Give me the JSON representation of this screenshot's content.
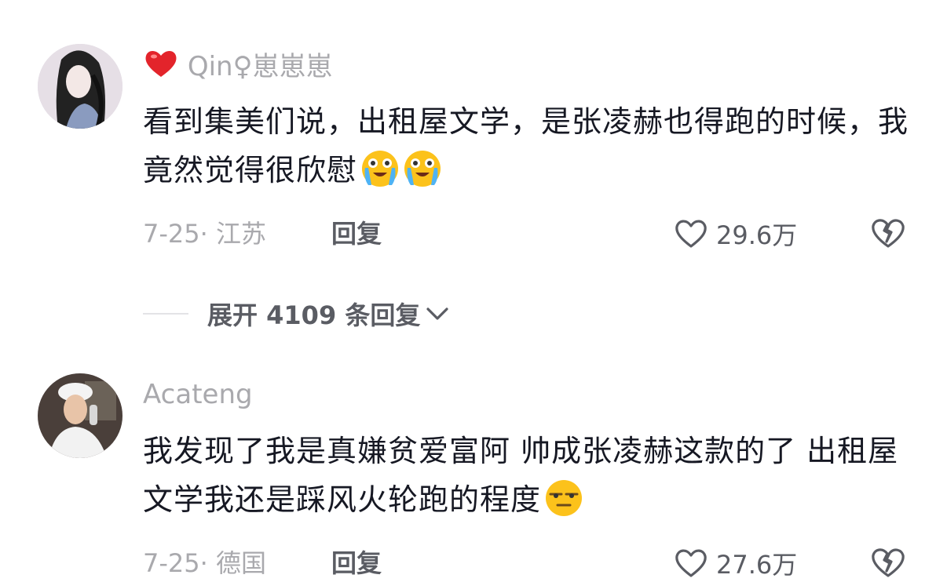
{
  "comments": [
    {
      "username": "Qin♀崽崽崽",
      "username_icon": "red-heart-icon",
      "text": "看到集美们说，出租屋文学，是张凌赫也得跑的时候，我竟然觉得很欣慰",
      "emojis": [
        "crying-emoji",
        "crying-emoji"
      ],
      "date_location": "7-25· 江苏",
      "reply_label": "回复",
      "likes": "29.6万"
    },
    {
      "username": "Acateng",
      "text": "我发现了我是真嫌贫爱富阿 帅成张凌赫这款的了 出租屋文学我还是踩风火轮跑的程度",
      "emojis": [
        "eye-roll-emoji"
      ],
      "date_location": "7-25· 德国",
      "reply_label": "回复",
      "likes": "27.6万"
    }
  ],
  "expand_replies": "展开 4109 条回复",
  "colors": {
    "primary_text": "#161823",
    "secondary_text": "#a9a9ad",
    "action_text": "#5a5c63"
  }
}
